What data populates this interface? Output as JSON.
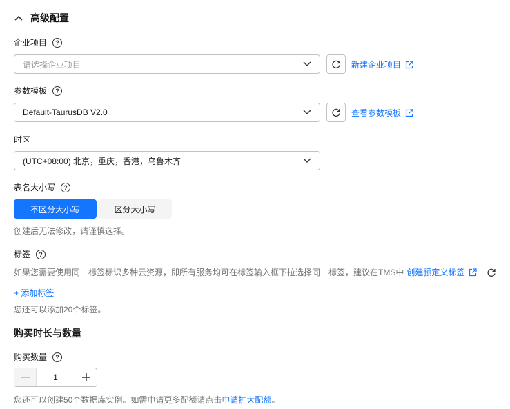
{
  "section": {
    "title": "高级配置"
  },
  "enterprise": {
    "label": "企业项目",
    "placeholder": "请选择企业项目",
    "link": "新建企业项目"
  },
  "param_template": {
    "label": "参数模板",
    "value": "Default-TaurusDB V2.0",
    "link": "查看参数模板"
  },
  "timezone": {
    "label": "时区",
    "value": "(UTC+08:00) 北京，重庆，香港，乌鲁木齐"
  },
  "case": {
    "label": "表名大小写",
    "options": [
      "不区分大小写",
      "区分大小写"
    ],
    "selected": "不区分大小写",
    "hint": "创建后无法修改，请谨慎选择。"
  },
  "tags": {
    "label": "标签",
    "desc": "如果您需要使用同一标签标识多种云资源，即所有服务均可在标签输入框下拉选择同一标签，建议在TMS中",
    "link": "创建预定义标签",
    "add": "+ 添加标签",
    "remaining": "您还可以添加20个标签。"
  },
  "purchase": {
    "title": "购买时长与数量",
    "qty_label": "购买数量",
    "qty": "1",
    "hint_prefix": "您还可以创建50个数据库实例。如需申请更多配额请点击",
    "hint_link": "申请扩大配额",
    "hint_suffix": "。"
  },
  "colors": {
    "primary": "#1476ff",
    "border": "#c2c2c2",
    "muted": "#757575"
  }
}
